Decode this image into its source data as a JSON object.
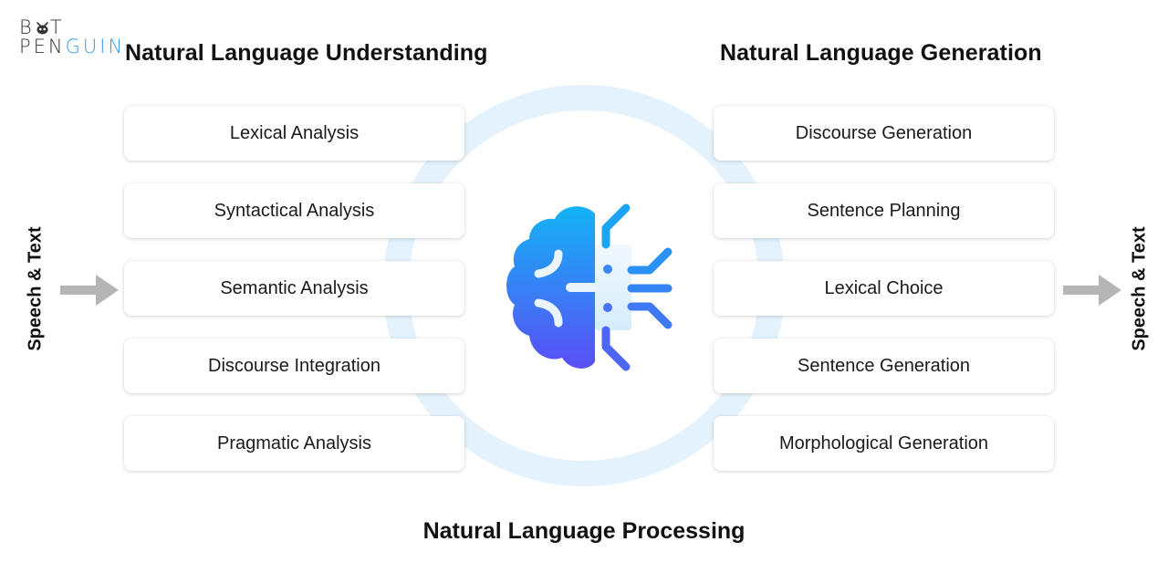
{
  "logo": {
    "line1": "B",
    "line1_end": "T",
    "line2_plain": "PEN",
    "line2_accent": "GUIN",
    "icon": "robot-face-icon",
    "accent_color": "#3a9be6"
  },
  "nlu": {
    "title": "Natural Language Understanding",
    "steps": [
      "Lexical Analysis",
      "Syntactical Analysis",
      "Semantic Analysis",
      "Discourse Integration",
      "Pragmatic Analysis"
    ]
  },
  "nlg": {
    "title": "Natural Language Generation",
    "steps": [
      "Discourse Generation",
      "Sentence Planning",
      "Lexical Choice",
      "Sentence Generation",
      "Morphological Generation"
    ]
  },
  "input": {
    "label": "Speech & Text",
    "icon": "arrow-right-icon"
  },
  "output": {
    "label": "Speech & Text",
    "icon": "arrow-right-icon"
  },
  "center": {
    "icon": "brain-circuit-icon",
    "ring_color": "#e3f2fc",
    "gradient_top": "#12b3f5",
    "gradient_bottom": "#5a4ff5"
  },
  "footer": {
    "title": "Natural Language Processing"
  }
}
